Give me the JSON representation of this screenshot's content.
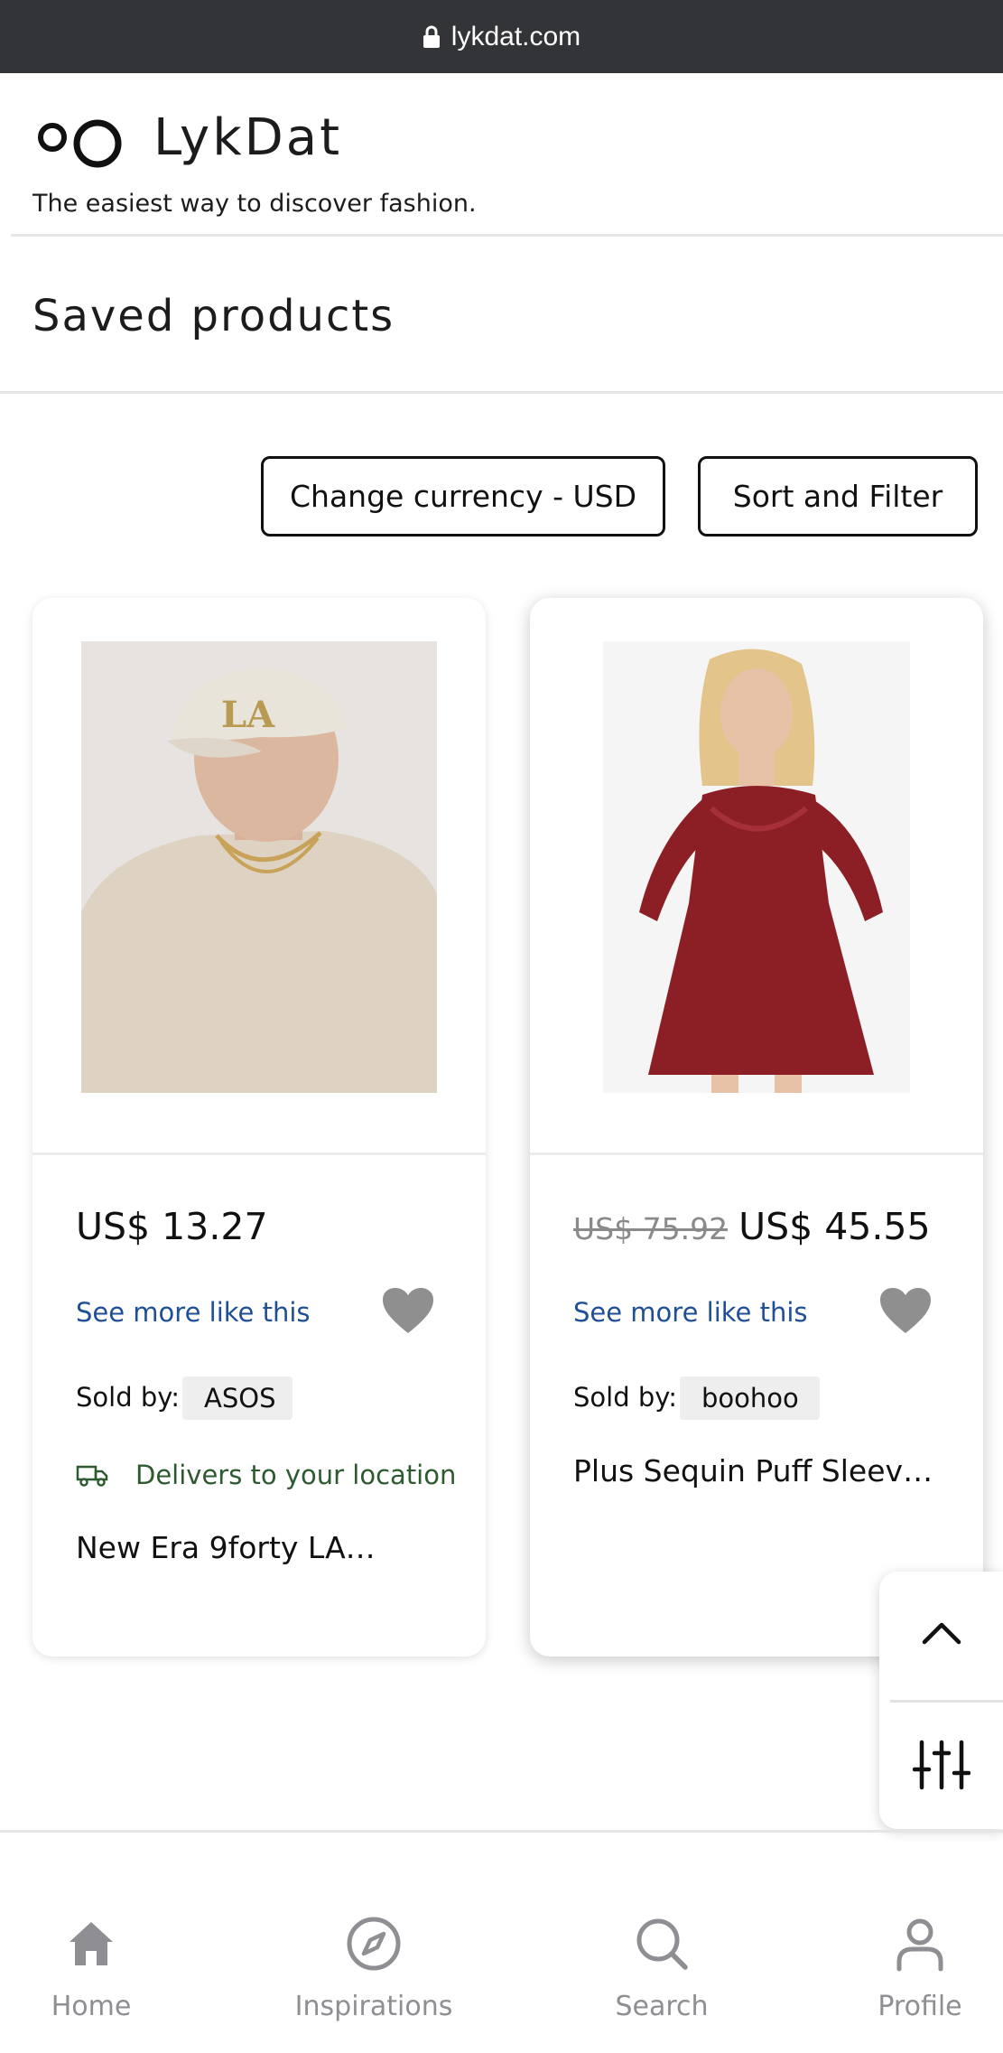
{
  "browser": {
    "url": "lykdat.com"
  },
  "header": {
    "brand": "LykDat",
    "tagline": "The easiest way to discover fashion."
  },
  "page": {
    "title": "Saved products"
  },
  "actions": {
    "currency_label": "Change currency - USD",
    "sort_filter_label": "Sort and Filter"
  },
  "products": [
    {
      "price": "US$ 13.27",
      "old_price": "",
      "see_more": "See more like this",
      "sold_by_label": "Sold by:",
      "seller": "ASOS",
      "delivery": "Delivers to your location",
      "name": "New Era 9forty LA…"
    },
    {
      "old_price": "US$ 75.92",
      "price": "US$ 45.55",
      "see_more": "See more like this",
      "sold_by_label": "Sold by:",
      "seller": "boohoo",
      "name": "Plus Sequin Puff Sleev…"
    }
  ],
  "bottom_nav": [
    {
      "label": "Home",
      "icon": "home-icon"
    },
    {
      "label": "Inspirations",
      "icon": "compass-icon"
    },
    {
      "label": "Search",
      "icon": "search-icon"
    },
    {
      "label": "Profile",
      "icon": "profile-icon"
    }
  ],
  "colors": {
    "link": "#1f4f96",
    "delivery": "#2e5a2f",
    "heart": "#8f8f8f",
    "nav": "#8e8e93",
    "urlbar": "#333437"
  }
}
